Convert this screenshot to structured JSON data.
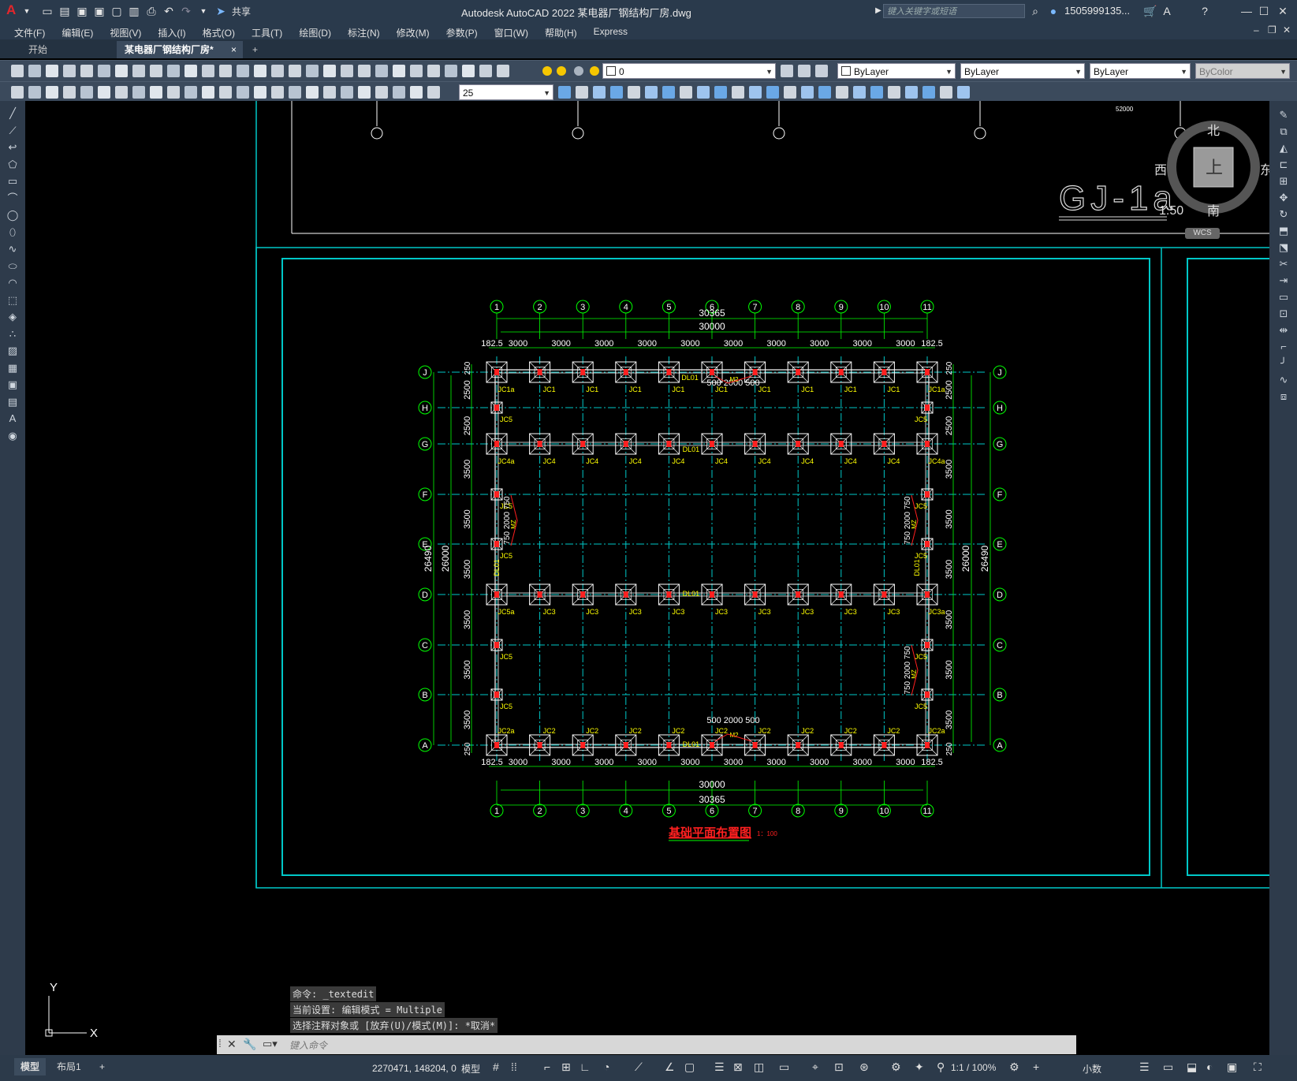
{
  "titlebar": {
    "app_title": "Autodesk AutoCAD 2022    某电器厂钢结构厂房.dwg",
    "share_label": "共享",
    "search_placeholder": "键入关键字或短语",
    "user": "1505999135...",
    "logo": "A"
  },
  "menu": [
    "文件(F)",
    "编辑(E)",
    "视图(V)",
    "插入(I)",
    "格式(O)",
    "工具(T)",
    "绘图(D)",
    "标注(N)",
    "修改(M)",
    "参数(P)",
    "窗口(W)",
    "帮助(H)",
    "Express"
  ],
  "tabs": {
    "start": "开始",
    "drawing": "某电器厂钢结构厂房*",
    "close": "×",
    "add": "+"
  },
  "properties": {
    "layer": "0",
    "color": "ByLayer",
    "linetype": "ByLayer",
    "lineweight": "ByLayer",
    "plotstyle": "ByColor",
    "dim_value": "25"
  },
  "viewcube": {
    "north": "北",
    "south": "南",
    "east": "东",
    "west": "西",
    "face": "上",
    "wcs": "WCS"
  },
  "drawing": {
    "upper_label": "GJ-1a",
    "upper_scale": "1:50",
    "top_dim": "52000",
    "plan_title": "基础平面布置图",
    "plan_scale": "1：100",
    "col_axes": [
      "1",
      "2",
      "3",
      "4",
      "5",
      "6",
      "7",
      "8",
      "9",
      "10",
      "11"
    ],
    "row_axes": [
      "J",
      "H",
      "G",
      "F",
      "E",
      "D",
      "C",
      "B",
      "A"
    ],
    "overall_x": "30365",
    "total_x": "30000",
    "bay_x": "3000",
    "edge_x": "182.5",
    "overall_y": "26490",
    "total_y": "26000",
    "bay_y_top": "2500",
    "bay_y": "3500",
    "edge_y": "250",
    "footing_top_row": [
      "JC1a",
      "JC1",
      "JC1",
      "JC1",
      "JC1",
      "JC1",
      "JC1",
      "JC1",
      "JC1",
      "JC1",
      "JC1a"
    ],
    "footing_g_row": [
      "JC4a",
      "JC4",
      "JC4",
      "JC4",
      "JC4",
      "JC4",
      "JC4",
      "JC4",
      "JC4",
      "JC4",
      "JC4a"
    ],
    "footing_d_row": [
      "JC5a",
      "JC3",
      "JC3",
      "JC3",
      "JC3",
      "JC3",
      "JC3",
      "JC3",
      "JC3",
      "JC3",
      "JC3a"
    ],
    "footing_a_row": [
      "JC2a",
      "JC2",
      "JC2",
      "JC2",
      "JC2",
      "JC2",
      "JC2",
      "JC2",
      "JC2",
      "JC2",
      "JC2a"
    ],
    "jc5": "JC5",
    "beam": "DL01",
    "door": "M2",
    "mz": "MZ",
    "door_dims": "500 2000 500",
    "side_door_dims": "750 2000 750"
  },
  "ucs": {
    "x": "X",
    "y": "Y"
  },
  "command": {
    "history": [
      "命令: _textedit",
      "当前设置: 编辑模式 = Multiple",
      "选择注释对象或 [放弃(U)/模式(M)]: *取消*"
    ],
    "placeholder": "键入命令"
  },
  "status": {
    "model_tab": "模型",
    "layout_tab": "布局1",
    "add_tab": "+",
    "coords": "2270471, 148204, 0",
    "model": "模型",
    "scale": "1:1 / 100%",
    "units": "小数"
  },
  "colors": {
    "cyan": "#00c8c8",
    "green": "#00ff00",
    "yellow": "#ffff00",
    "red": "#ff2020",
    "white": "#ffffff",
    "ui_dark": "#2a3a4c"
  }
}
